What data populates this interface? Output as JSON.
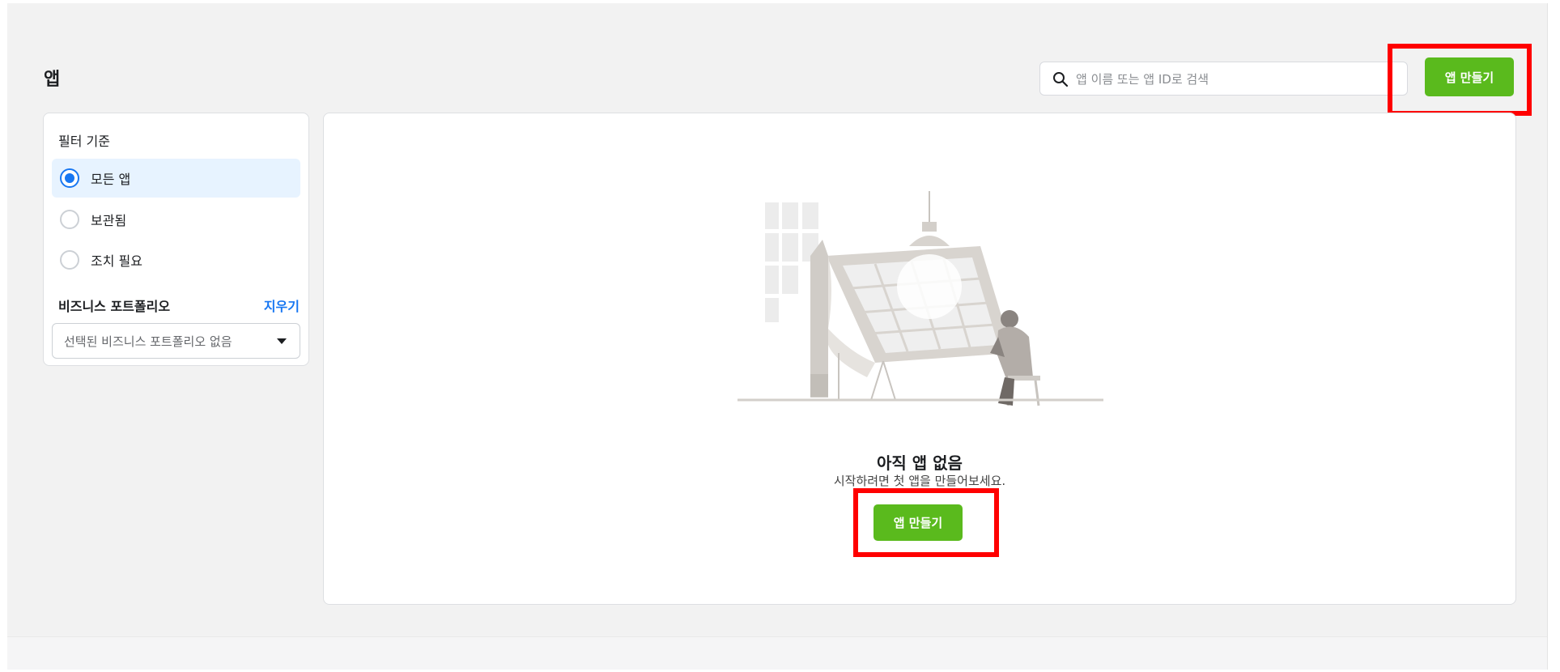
{
  "header": {
    "title": "앱",
    "search_placeholder": "앱 이름 또는 앱 ID로 검색",
    "create_button": "앱 만들기"
  },
  "filters": {
    "title": "필터 기준",
    "options": [
      {
        "label": "모든 앱",
        "selected": true
      },
      {
        "label": "보관됨",
        "selected": false
      },
      {
        "label": "조치 필요",
        "selected": false
      }
    ],
    "portfolio": {
      "label": "비즈니스 포트폴리오",
      "clear": "지우기",
      "selected_value": "선택된 비즈니스 포트폴리오 없음"
    }
  },
  "empty_state": {
    "title": "아직 앱 없음",
    "subtitle": "시작하려면 첫 앱을 만들어보세요.",
    "create_button": "앱 만들기"
  },
  "colors": {
    "accent_green": "#5aba1d",
    "selection_blue": "#1877f2",
    "highlight_red": "#ff0000"
  },
  "icons": {
    "search": "search-icon",
    "dropdown": "caret-down-icon"
  }
}
